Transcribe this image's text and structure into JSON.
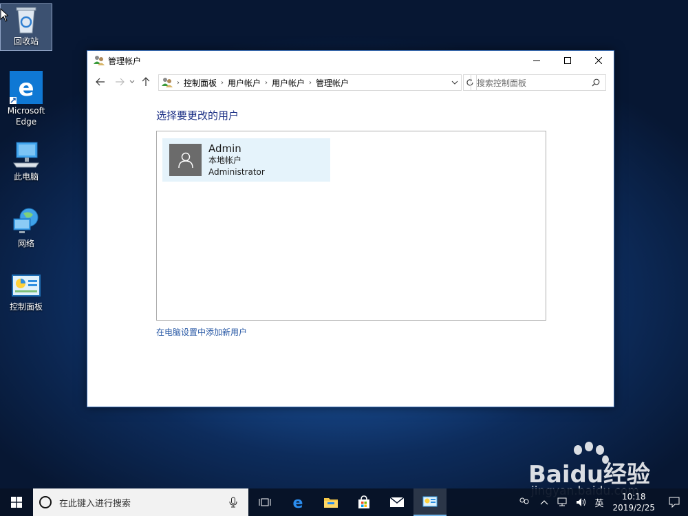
{
  "desktop": {
    "icons": [
      {
        "label": "回收站"
      },
      {
        "label": "Microsoft Edge"
      },
      {
        "label": "此电脑"
      },
      {
        "label": "网络"
      },
      {
        "label": "控制面板"
      }
    ]
  },
  "window": {
    "title": "管理帐户",
    "breadcrumbs": [
      "控制面板",
      "用户帐户",
      "用户帐户",
      "管理帐户"
    ],
    "search_placeholder": "搜索控制面板",
    "heading": "选择要更改的用户",
    "users": [
      {
        "name": "Admin",
        "type": "本地帐户",
        "role": "Administrator"
      }
    ],
    "add_user_link": "在电脑设置中添加新用户"
  },
  "taskbar": {
    "search_placeholder": "在此键入进行搜索",
    "ime": "英",
    "time": "10:18",
    "date": "2019/2/25"
  },
  "watermark": {
    "brand": "Baidu经验",
    "url": "jingyan.baidu.com"
  },
  "colors": {
    "accent": "#0078d7",
    "heading": "#1e3287",
    "link": "#2a5aa6",
    "selection": "#e5f3fb"
  }
}
